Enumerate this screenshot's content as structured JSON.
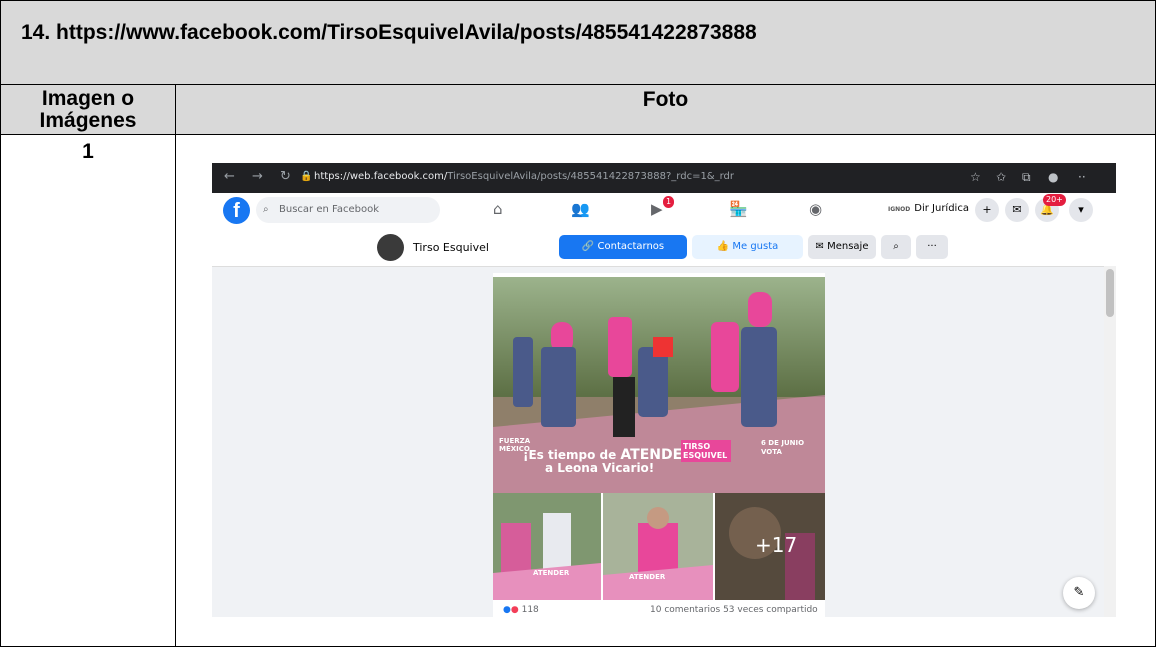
{
  "doc": {
    "title": "14. https://www.facebook.com/TirsoEsquivelAvila/posts/485541422873888",
    "col1_header": "Imagen o Imágenes",
    "col2_header": "Foto",
    "row_number": "1"
  },
  "browser": {
    "url_prefix": "https://web.facebook.com/",
    "url_rest": "TirsoEsquivelAvila/posts/485541422873888?_rdc=1&_rdr"
  },
  "fb": {
    "search_placeholder": "Buscar en Facebook",
    "watch_badge": "1",
    "account_name": "Dir Jurídica",
    "account_tag": "IGNOD",
    "notif_badge": "20+"
  },
  "page": {
    "name": "Tirso Esquivel",
    "contact_label": "Contactarnos",
    "like_label": "Me gusta",
    "message_label": "Mensaje"
  },
  "post": {
    "main_caption_1": "¡Es tiempo de",
    "main_caption_bold": "ATENDER",
    "main_caption_2": "a Leona Vicario!",
    "brand_left": "FUERZA MÉXICO",
    "brand_mid": "TIRSO ESQUIVEL",
    "brand_right": "6 DE JUNIO VOTA",
    "thumb_label": "ATENDER",
    "more_photos": "+17",
    "reaction_count": "118",
    "comments_shares": "10 comentarios  53 veces compartido"
  },
  "colors": {
    "fb_blue": "#1877f2",
    "pink": "#e8479a"
  }
}
